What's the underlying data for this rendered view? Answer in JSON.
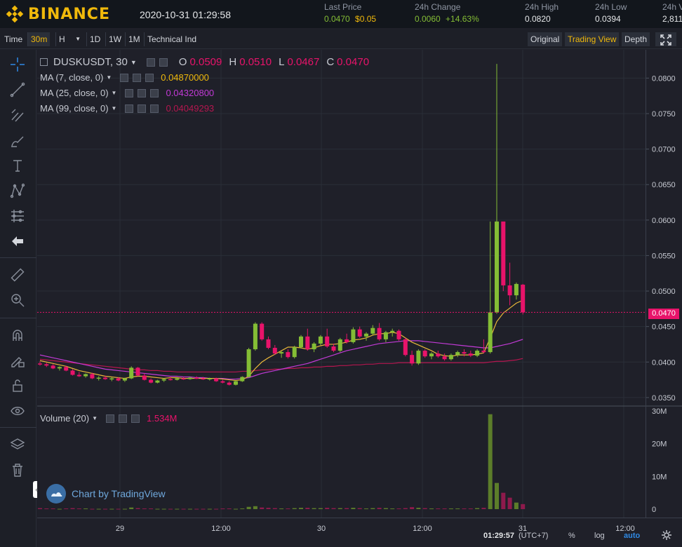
{
  "header": {
    "brand": "BINANCE",
    "datetime": "2020-10-31 01:29:58",
    "last_price_label": "Last Price",
    "last_price": "0.0470",
    "last_price_usd": "$0.05",
    "change_label": "24h Change",
    "change_value": "0.0060",
    "change_pct": "+14.63%",
    "high_label": "24h High",
    "high_value": "0.0820",
    "low_label": "24h Low",
    "low_value": "0.0394",
    "vol_label": "24h V",
    "vol_value": "2,811"
  },
  "toolbar": {
    "time": "Time",
    "interval": "30m",
    "h": "H",
    "d1": "1D",
    "w1": "1W",
    "m1": "1M",
    "tech": "Technical Ind",
    "original": "Original",
    "tradingview": "Trading View",
    "depth": "Depth"
  },
  "legend": {
    "symbol": "DUSKUSDT, 30",
    "o_label": "O",
    "o": "0.0509",
    "h_label": "H",
    "h": "0.0510",
    "l_label": "L",
    "l": "0.0467",
    "c_label": "C",
    "c": "0.0470",
    "ma7": "MA (7, close, 0)",
    "ma7_val": "0.04870000",
    "ma25": "MA (25, close, 0)",
    "ma25_val": "0.04320800",
    "ma99": "MA (99, close, 0)",
    "ma99_val": "0.04049293",
    "volume": "Volume (20)",
    "volume_val": "1.534M",
    "tv_credit": "Chart by TradingView"
  },
  "colors": {
    "up": "#84bd35",
    "down": "#e8136a",
    "ma7": "#e8b73a",
    "ma25": "#c23ad6",
    "ma99": "#b5164f",
    "accent": "#f0b90b"
  },
  "price_axis": {
    "ticks": [
      "0.0800",
      "0.0750",
      "0.0700",
      "0.0650",
      "0.0600",
      "0.0550",
      "0.0500",
      "0.0450",
      "0.0400",
      "0.0350"
    ],
    "current": "0.0470"
  },
  "volume_axis": {
    "ticks": [
      "30M",
      "20M",
      "10M",
      "0"
    ]
  },
  "time_axis": {
    "ticks": [
      "29",
      "12:00",
      "30",
      "12:00",
      "31",
      "12:00"
    ]
  },
  "footer": {
    "clock": "01:29:57",
    "tz": "(UTC+7)",
    "pct": "%",
    "log": "log",
    "auto": "auto"
  },
  "chart_data": {
    "type": "candlestick",
    "candles": [
      [
        0.0398,
        0.0401,
        0.0395,
        0.0397
      ],
      [
        0.0397,
        0.0399,
        0.0393,
        0.0395
      ],
      [
        0.0395,
        0.0397,
        0.039,
        0.0391
      ],
      [
        0.0391,
        0.0394,
        0.0388,
        0.0393
      ],
      [
        0.0393,
        0.0395,
        0.0387,
        0.0388
      ],
      [
        0.0388,
        0.039,
        0.0381,
        0.0382
      ],
      [
        0.0382,
        0.0386,
        0.0379,
        0.038
      ],
      [
        0.038,
        0.0384,
        0.0378,
        0.0383
      ],
      [
        0.0383,
        0.0385,
        0.0376,
        0.0377
      ],
      [
        0.0377,
        0.038,
        0.0374,
        0.0378
      ],
      [
        0.0378,
        0.0381,
        0.0375,
        0.0376
      ],
      [
        0.0376,
        0.0379,
        0.0373,
        0.0377
      ],
      [
        0.0377,
        0.0379,
        0.0373,
        0.0374
      ],
      [
        0.0374,
        0.0378,
        0.0372,
        0.0377
      ],
      [
        0.0377,
        0.0394,
        0.0376,
        0.0392
      ],
      [
        0.0392,
        0.0393,
        0.038,
        0.0381
      ],
      [
        0.0381,
        0.0384,
        0.0374,
        0.0375
      ],
      [
        0.0375,
        0.0377,
        0.037,
        0.0371
      ],
      [
        0.0371,
        0.0375,
        0.037,
        0.0374
      ],
      [
        0.0374,
        0.0377,
        0.0372,
        0.0376
      ],
      [
        0.0376,
        0.0379,
        0.0374,
        0.0375
      ],
      [
        0.0375,
        0.0378,
        0.0374,
        0.0377
      ],
      [
        0.0377,
        0.0379,
        0.0375,
        0.0376
      ],
      [
        0.0376,
        0.0379,
        0.0375,
        0.0378
      ],
      [
        0.0378,
        0.038,
        0.0376,
        0.0377
      ],
      [
        0.0377,
        0.0379,
        0.0375,
        0.0376
      ],
      [
        0.0376,
        0.0378,
        0.0374,
        0.0377
      ],
      [
        0.0377,
        0.0378,
        0.0372,
        0.0373
      ],
      [
        0.0373,
        0.0375,
        0.037,
        0.0371
      ],
      [
        0.0371,
        0.0373,
        0.0367,
        0.0368
      ],
      [
        0.0368,
        0.0374,
        0.0367,
        0.0373
      ],
      [
        0.0373,
        0.038,
        0.0372,
        0.0379
      ],
      [
        0.0379,
        0.042,
        0.0378,
        0.0418
      ],
      [
        0.0418,
        0.0456,
        0.0416,
        0.0454
      ],
      [
        0.0454,
        0.0456,
        0.043,
        0.0432
      ],
      [
        0.0432,
        0.0436,
        0.0418,
        0.042
      ],
      [
        0.042,
        0.0424,
        0.041,
        0.0412
      ],
      [
        0.0412,
        0.0416,
        0.0406,
        0.0414
      ],
      [
        0.0414,
        0.0418,
        0.0405,
        0.0407
      ],
      [
        0.0407,
        0.0423,
        0.0405,
        0.0421
      ],
      [
        0.0421,
        0.0438,
        0.0419,
        0.0436
      ],
      [
        0.0436,
        0.0447,
        0.0416,
        0.0418
      ],
      [
        0.0418,
        0.0428,
        0.0414,
        0.0426
      ],
      [
        0.0426,
        0.0438,
        0.0424,
        0.0436
      ],
      [
        0.0436,
        0.0447,
        0.042,
        0.0422
      ],
      [
        0.0422,
        0.0426,
        0.0414,
        0.0416
      ],
      [
        0.0416,
        0.0434,
        0.0414,
        0.0432
      ],
      [
        0.0432,
        0.044,
        0.0426,
        0.0428
      ],
      [
        0.0428,
        0.0449,
        0.0426,
        0.0446
      ],
      [
        0.0446,
        0.045,
        0.0434,
        0.0436
      ],
      [
        0.0436,
        0.0442,
        0.043,
        0.044
      ],
      [
        0.044,
        0.0452,
        0.0438,
        0.0448
      ],
      [
        0.0448,
        0.0455,
        0.043,
        0.0432
      ],
      [
        0.0432,
        0.0444,
        0.0428,
        0.0442
      ],
      [
        0.0442,
        0.0447,
        0.0436,
        0.0444
      ],
      [
        0.0444,
        0.0446,
        0.043,
        0.0432
      ],
      [
        0.0432,
        0.0434,
        0.0408,
        0.041
      ],
      [
        0.041,
        0.0416,
        0.0395,
        0.0398
      ],
      [
        0.0398,
        0.0418,
        0.0396,
        0.0416
      ],
      [
        0.0416,
        0.0418,
        0.0406,
        0.0408
      ],
      [
        0.0408,
        0.0414,
        0.0404,
        0.0412
      ],
      [
        0.0412,
        0.0416,
        0.0406,
        0.0408
      ],
      [
        0.0408,
        0.0412,
        0.0402,
        0.0404
      ],
      [
        0.0404,
        0.0412,
        0.0402,
        0.041
      ],
      [
        0.041,
        0.0416,
        0.0407,
        0.0414
      ],
      [
        0.0414,
        0.0418,
        0.0408,
        0.0412
      ],
      [
        0.0412,
        0.0416,
        0.0407,
        0.0409
      ],
      [
        0.0409,
        0.0418,
        0.0407,
        0.0416
      ],
      [
        0.0416,
        0.0432,
        0.0412,
        0.0414
      ],
      [
        0.0414,
        0.0598,
        0.0412,
        0.047
      ],
      [
        0.047,
        0.082,
        0.0468,
        0.0598
      ],
      [
        0.0598,
        0.0546,
        0.05,
        0.0508
      ],
      [
        0.0508,
        0.054,
        0.048,
        0.0494
      ],
      [
        0.0494,
        0.0512,
        0.0488,
        0.051
      ],
      [
        0.0509,
        0.051,
        0.0467,
        0.047
      ]
    ],
    "volumes_M": [
      0.3,
      0.2,
      0.2,
      0.1,
      0.2,
      0.3,
      0.2,
      0.2,
      0.1,
      0.1,
      0.1,
      0.1,
      0.1,
      0.1,
      0.5,
      0.3,
      0.2,
      0.2,
      0.1,
      0.1,
      0.1,
      0.1,
      0.1,
      0.1,
      0.1,
      0.1,
      0.1,
      0.1,
      0.2,
      0.2,
      0.1,
      0.2,
      0.7,
      0.9,
      0.5,
      0.4,
      0.3,
      0.2,
      0.2,
      0.3,
      0.4,
      0.4,
      0.3,
      0.3,
      0.4,
      0.3,
      0.3,
      0.3,
      0.4,
      0.3,
      0.2,
      0.3,
      0.4,
      0.3,
      0.2,
      0.2,
      0.3,
      0.6,
      0.4,
      0.3,
      0.2,
      0.2,
      0.2,
      0.2,
      0.2,
      0.2,
      0.2,
      0.3,
      0.4,
      29.0,
      8.0,
      5.0,
      3.5,
      2.0,
      1.534
    ],
    "ma7": [
      0.0402,
      0.04,
      0.0398,
      0.0396,
      0.0394,
      0.0391,
      0.0388,
      0.0386,
      0.0384,
      0.0382,
      0.038,
      0.0379,
      0.0378,
      0.0377,
      0.0379,
      0.038,
      0.038,
      0.0379,
      0.0378,
      0.0377,
      0.0378,
      0.0378,
      0.0377,
      0.0377,
      0.0377,
      0.0377,
      0.0377,
      0.0377,
      0.0376,
      0.0375,
      0.0374,
      0.0375,
      0.038,
      0.0391,
      0.04,
      0.0406,
      0.0411,
      0.0416,
      0.0421,
      0.0421,
      0.042,
      0.0418,
      0.042,
      0.0423,
      0.0425,
      0.0425,
      0.0426,
      0.0428,
      0.0431,
      0.0432,
      0.0434,
      0.0438,
      0.044,
      0.044,
      0.0442,
      0.044,
      0.0434,
      0.0428,
      0.0424,
      0.042,
      0.0416,
      0.0411,
      0.0409,
      0.0408,
      0.041,
      0.041,
      0.041,
      0.0411,
      0.0413,
      0.0434,
      0.0457,
      0.0469,
      0.0476,
      0.0483,
      0.0487
    ],
    "ma25": [
      0.041,
      0.0408,
      0.0406,
      0.0404,
      0.0402,
      0.04,
      0.0398,
      0.0396,
      0.0394,
      0.0392,
      0.039,
      0.0389,
      0.0388,
      0.0387,
      0.0386,
      0.0385,
      0.0384,
      0.0383,
      0.0382,
      0.0381,
      0.038,
      0.038,
      0.0379,
      0.0379,
      0.0378,
      0.0378,
      0.0377,
      0.0377,
      0.0377,
      0.0376,
      0.0376,
      0.0377,
      0.0378,
      0.0381,
      0.0384,
      0.0386,
      0.0388,
      0.039,
      0.0392,
      0.0394,
      0.0396,
      0.0398,
      0.0401,
      0.0404,
      0.0407,
      0.041,
      0.0413,
      0.0416,
      0.0418,
      0.042,
      0.0422,
      0.0424,
      0.0426,
      0.0427,
      0.0428,
      0.0429,
      0.043,
      0.043,
      0.043,
      0.0429,
      0.0428,
      0.0427,
      0.0426,
      0.0425,
      0.0424,
      0.0423,
      0.0422,
      0.0421,
      0.042,
      0.042,
      0.0422,
      0.0424,
      0.0426,
      0.0429,
      0.0432
    ],
    "ma99": [
      0.0404,
      0.0403,
      0.0402,
      0.0401,
      0.04,
      0.0399,
      0.0398,
      0.0397,
      0.0396,
      0.0395,
      0.0394,
      0.0393,
      0.0392,
      0.0391,
      0.039,
      0.0389,
      0.0389,
      0.0388,
      0.0388,
      0.0387,
      0.0387,
      0.0386,
      0.0386,
      0.0386,
      0.0386,
      0.0386,
      0.0386,
      0.0386,
      0.0386,
      0.0386,
      0.0386,
      0.0387,
      0.0387,
      0.0388,
      0.0389,
      0.0389,
      0.039,
      0.039,
      0.0391,
      0.0391,
      0.0392,
      0.0392,
      0.0393,
      0.0393,
      0.0394,
      0.0394,
      0.0395,
      0.0395,
      0.0396,
      0.0396,
      0.0397,
      0.0397,
      0.0398,
      0.0398,
      0.0398,
      0.0399,
      0.0399,
      0.0399,
      0.0399,
      0.0399,
      0.0399,
      0.0399,
      0.0399,
      0.0399,
      0.0399,
      0.0399,
      0.0399,
      0.0399,
      0.0399,
      0.04,
      0.0401,
      0.0401,
      0.0402,
      0.0403,
      0.0405
    ],
    "price_range": [
      0.034,
      0.083
    ],
    "volume_range_M": [
      0,
      30
    ]
  }
}
